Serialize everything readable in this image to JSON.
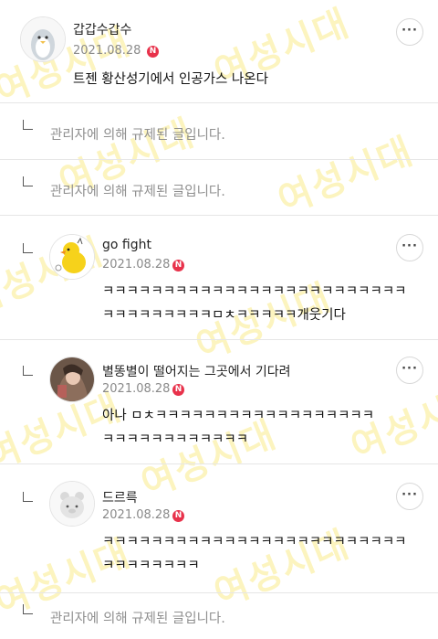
{
  "watermark_text": "여성시대",
  "badge_letter": "N",
  "more_label": "···",
  "comments": [
    {
      "nickname": "갑갑수갑수",
      "date": "2021.08.28",
      "lines": [
        "트젠 황산성기에서 인공가스 나온다"
      ],
      "avatar": "penguin-avatar"
    },
    {
      "deleted_text": "관리자에 의해 규제된 글입니다."
    },
    {
      "deleted_text": "관리자에 의해 규제된 글입니다."
    },
    {
      "nickname": "go fight",
      "date": "2021.08.28",
      "lines": [
        "ㅋㅋㅋㅋㅋㅋㅋㅋㅋㅋㅋㅋㅋㅋㅋㅋㅋㅋㅋㅋㅋㅋㅋㅋㅋ",
        "ㅋㅋㅋㅋㅋㅋㅋㅋㅋㅁㅊㅋㅋㅋㅋㅋ개웃기다"
      ],
      "avatar": "duck-avatar"
    },
    {
      "nickname": "별똥별이 떨어지는 그곳에서 기다려",
      "date": "2021.08.28",
      "lines": [
        "아나 ㅁㅊㅋㅋㅋㅋㅋㅋㅋㅋㅋㅋㅋㅋㅋㅋㅋㅋㅋㅋ",
        "ㅋㅋㅋㅋㅋㅋㅋㅋㅋㅋㅋㅋ"
      ],
      "avatar": "character-avatar"
    },
    {
      "nickname": "드르륵",
      "date": "2021.08.28",
      "lines": [
        "ㅋㅋㅋㅋㅋㅋㅋㅋㅋㅋㅋㅋㅋㅋㅋㅋㅋㅋㅋㅋㅋㅋㅋㅋㅋ",
        "ㅋㅋㅋㅋㅋㅋㅋㅋ"
      ],
      "avatar": "bear-avatar"
    },
    {
      "deleted_text": "관리자에 의해 규제된 글입니다."
    }
  ],
  "colors": {
    "badge": "#e8324b",
    "watermark": "#f5de3c",
    "deleted": "#8f8f8f",
    "date": "#8a8a8a"
  }
}
